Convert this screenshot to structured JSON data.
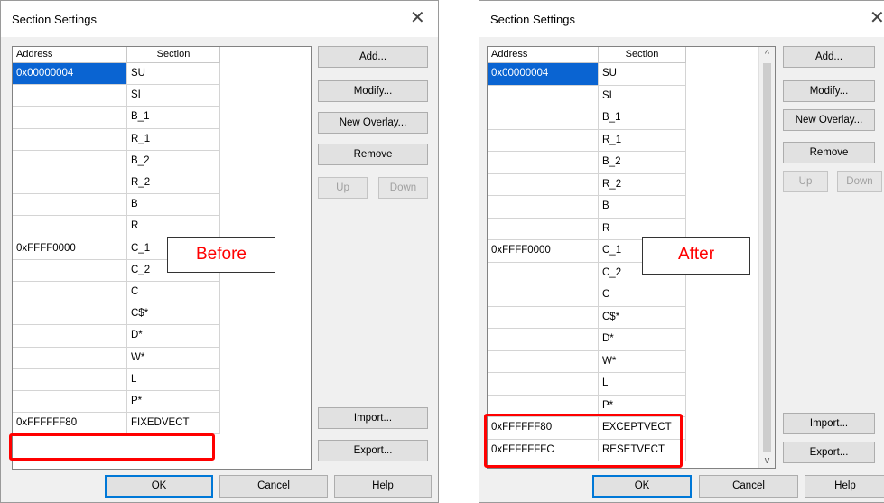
{
  "before": {
    "title": "Section Settings",
    "close_glyph": "✕",
    "columns": {
      "address": "Address",
      "section": "Section"
    },
    "rows": [
      {
        "address": "0x00000004",
        "section": "SU",
        "selected": true
      },
      {
        "address": "",
        "section": "SI"
      },
      {
        "address": "",
        "section": "B_1"
      },
      {
        "address": "",
        "section": "R_1"
      },
      {
        "address": "",
        "section": "B_2"
      },
      {
        "address": "",
        "section": "R_2"
      },
      {
        "address": "",
        "section": "B"
      },
      {
        "address": "",
        "section": "R"
      },
      {
        "address": "0xFFFF0000",
        "section": "C_1"
      },
      {
        "address": "",
        "section": "C_2"
      },
      {
        "address": "",
        "section": "C"
      },
      {
        "address": "",
        "section": "C$*"
      },
      {
        "address": "",
        "section": "D*"
      },
      {
        "address": "",
        "section": "W*"
      },
      {
        "address": "",
        "section": "L"
      },
      {
        "address": "",
        "section": "P*"
      },
      {
        "address": "0xFFFFFF80",
        "section": "FIXEDVECT"
      }
    ],
    "buttons": {
      "add": "Add...",
      "modify": "Modify...",
      "new_overlay": "New Overlay...",
      "remove": "Remove",
      "up": "Up",
      "down": "Down",
      "import": "Import...",
      "export": "Export...",
      "ok": "OK",
      "cancel": "Cancel",
      "help": "Help"
    },
    "callout": "Before"
  },
  "after": {
    "title": "Section Settings",
    "close_glyph": "✕",
    "columns": {
      "address": "Address",
      "section": "Section"
    },
    "rows": [
      {
        "address": "0x00000004",
        "section": "SU",
        "selected": true
      },
      {
        "address": "",
        "section": "SI"
      },
      {
        "address": "",
        "section": "B_1"
      },
      {
        "address": "",
        "section": "R_1"
      },
      {
        "address": "",
        "section": "B_2"
      },
      {
        "address": "",
        "section": "R_2"
      },
      {
        "address": "",
        "section": "B"
      },
      {
        "address": "",
        "section": "R"
      },
      {
        "address": "0xFFFF0000",
        "section": "C_1"
      },
      {
        "address": "",
        "section": "C_2"
      },
      {
        "address": "",
        "section": "C"
      },
      {
        "address": "",
        "section": "C$*"
      },
      {
        "address": "",
        "section": "D*"
      },
      {
        "address": "",
        "section": "W*"
      },
      {
        "address": "",
        "section": "L"
      },
      {
        "address": "",
        "section": "P*"
      },
      {
        "address": "0xFFFFFF80",
        "section": "EXCEPTVECT"
      },
      {
        "address": "0xFFFFFFFC",
        "section": "RESETVECT"
      }
    ],
    "scroll_up": "^",
    "scroll_down": "v",
    "buttons": {
      "add": "Add...",
      "modify": "Modify...",
      "new_overlay": "New Overlay...",
      "remove": "Remove",
      "up": "Up",
      "down": "Down",
      "import": "Import...",
      "export": "Export...",
      "ok": "OK",
      "cancel": "Cancel",
      "help": "Help"
    },
    "callout": "After"
  },
  "colors": {
    "highlight": "#ff0000",
    "selection": "#0a64d2",
    "callout_text": "#ff0000"
  }
}
